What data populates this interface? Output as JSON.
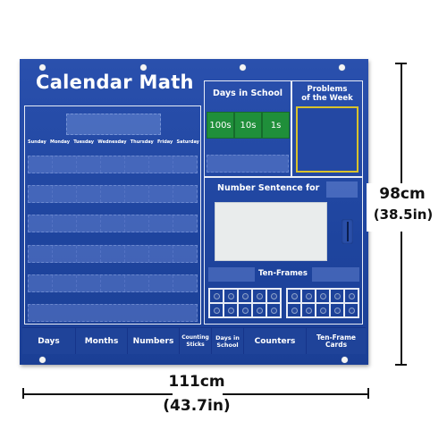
{
  "chart": {
    "title": "Calendar Math",
    "weekdays": [
      "Sunday",
      "Monday",
      "Tuesday",
      "Wednesday",
      "Thursday",
      "Friday",
      "Saturday"
    ],
    "days_in_school": {
      "title": "Days in School",
      "pockets": [
        "100s",
        "10s",
        "1s"
      ]
    },
    "problems_of_week": {
      "title_line1": "Problems",
      "title_line2": "of the Week"
    },
    "number_sentence": {
      "title": "Number Sentence for",
      "ten_frames_label": "Ten-Frames"
    },
    "bottom_pockets": [
      {
        "line1": "Days",
        "line2": ""
      },
      {
        "line1": "Months",
        "line2": ""
      },
      {
        "line1": "Numbers",
        "line2": ""
      },
      {
        "line1": "Counting",
        "line2": "Sticks"
      },
      {
        "line1": "Days in",
        "line2": "School"
      },
      {
        "line1": "Counters",
        "line2": ""
      },
      {
        "line1": "Ten-Frame",
        "line2": "Cards"
      }
    ],
    "colors": {
      "fabric_blue": "#1f45a0",
      "pocket_green": "#1f8f3a",
      "frame_yellow": "#d9c22a",
      "whiteboard": "#e9ecec"
    }
  },
  "dimensions": {
    "width_cm": "111cm",
    "width_in": "(43.7in)",
    "height_cm": "98cm",
    "height_in": "(38.5in)"
  }
}
